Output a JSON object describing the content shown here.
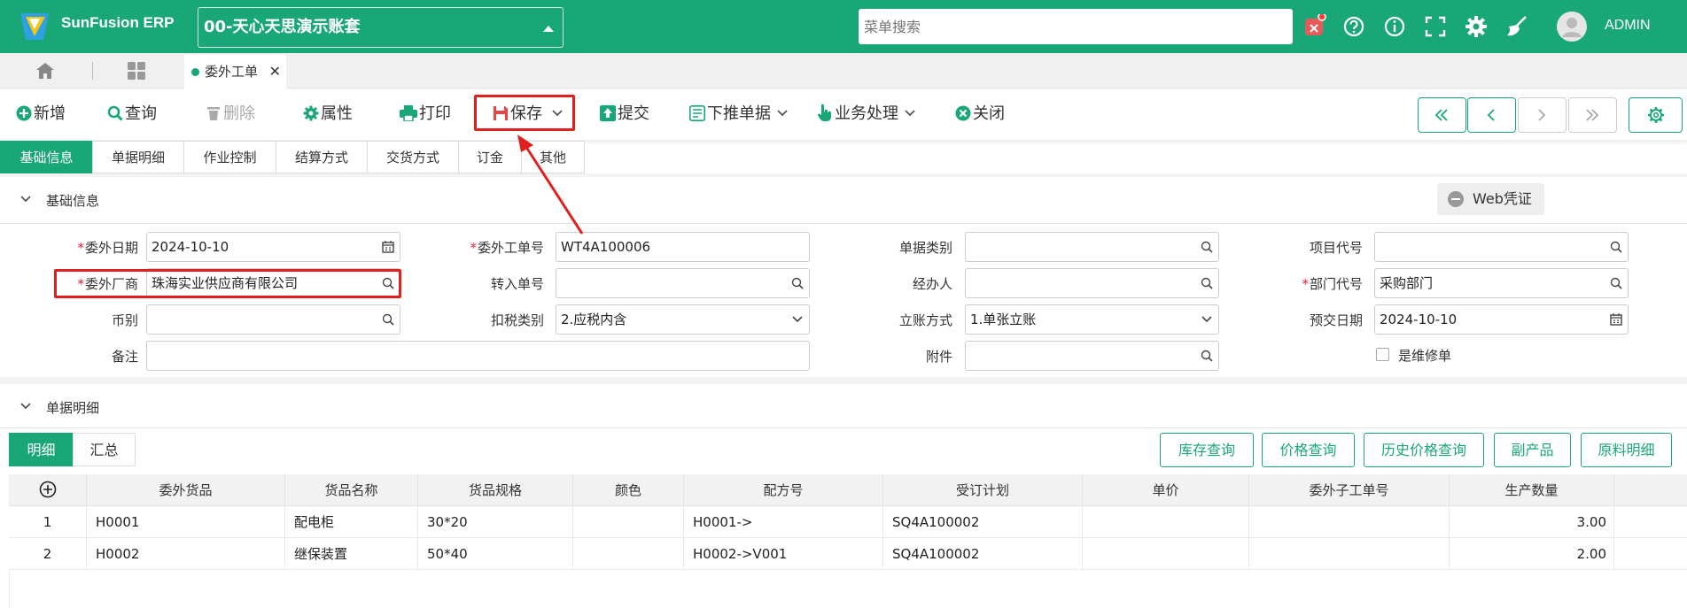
{
  "app": {
    "brand": "SunFusion ERP",
    "account": "00-天心天思演示账套",
    "search_placeholder": "菜单搜索",
    "user": "ADMIN"
  },
  "tabs": {
    "open_tab": "委外工单"
  },
  "toolbar": {
    "new": "新增",
    "query": "查询",
    "delete": "删除",
    "props": "属性",
    "print": "打印",
    "save": "保存",
    "submit": "提交",
    "push_down": "下推单据",
    "business": "业务处理",
    "close": "关闭"
  },
  "form_tabs": [
    "基础信息",
    "单据明细",
    "作业控制",
    "结算方式",
    "交货方式",
    "订金",
    "其他"
  ],
  "sections": {
    "basic": "基础信息",
    "detail": "单据明细"
  },
  "web_voucher": "Web凭证",
  "form": {
    "wwrq": {
      "label": "委外日期",
      "value": "2024-10-10"
    },
    "wwgdh": {
      "label": "委外工单号",
      "value": "WT4A100006"
    },
    "djlb": {
      "label": "单据类别",
      "value": ""
    },
    "xmdh": {
      "label": "项目代号",
      "value": ""
    },
    "wwcs": {
      "label": "委外厂商",
      "value": "珠海实业供应商有限公司"
    },
    "zrdh": {
      "label": "转入单号",
      "value": ""
    },
    "jbr": {
      "label": "经办人",
      "value": ""
    },
    "bmdh": {
      "label": "部门代号",
      "value": "采购部门"
    },
    "bb": {
      "label": "币别",
      "value": ""
    },
    "kslb": {
      "label": "扣税类别",
      "value": "2.应税内含"
    },
    "lzfs": {
      "label": "立账方式",
      "value": "1.单张立账"
    },
    "yjrq": {
      "label": "预交日期",
      "value": "2024-10-10"
    },
    "bz": {
      "label": "备注",
      "value": ""
    },
    "fj": {
      "label": "附件",
      "value": ""
    },
    "sfwxd": {
      "label": "是维修单"
    }
  },
  "detail_tabs": [
    "明细",
    "汇总"
  ],
  "detail_buttons": [
    "库存查询",
    "价格查询",
    "历史价格查询",
    "副产品",
    "原料明细"
  ],
  "grid": {
    "columns": [
      "委外货品",
      "货品名称",
      "货品规格",
      "颜色",
      "配方号",
      "受订计划",
      "单价",
      "委外子工单号",
      "生产数量"
    ],
    "rows": [
      [
        "1",
        "H0001",
        "配电柜",
        "30*20",
        "",
        "H0001->",
        "SQ4A100002",
        "",
        "",
        "3.00"
      ],
      [
        "2",
        "H0002",
        "继保装置",
        "50*40",
        "",
        "H0002->V001",
        "SQ4A100002",
        "",
        "",
        "2.00"
      ]
    ]
  },
  "colors": {
    "brand": "#1aa777",
    "highlight": "#e02020"
  }
}
